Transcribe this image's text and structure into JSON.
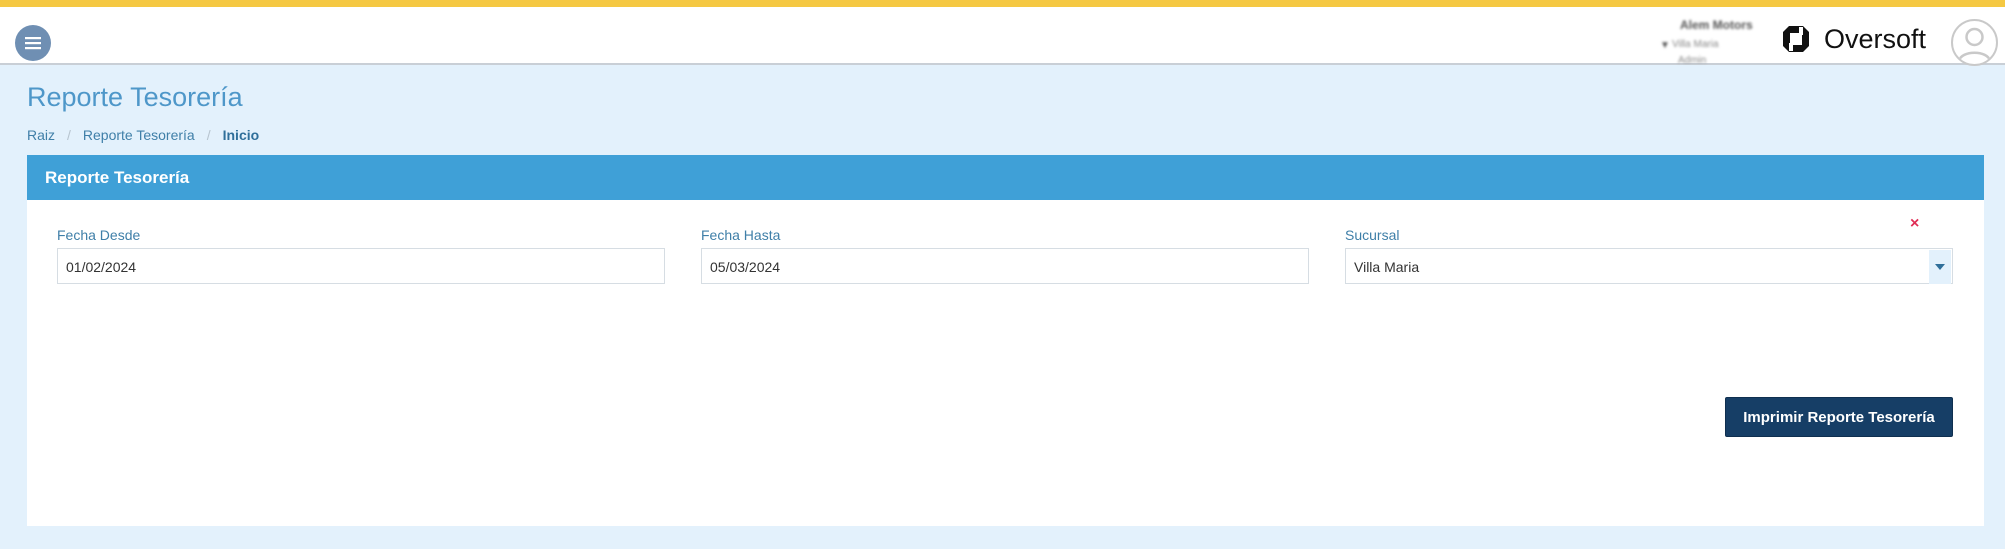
{
  "colors": {
    "accent_bar": "#f5c842",
    "header_bar": "#3fa0d7",
    "page_background": "#e3f1fc",
    "primary_button": "#163e66",
    "clear_icon": "#e02d55"
  },
  "navbar": {
    "menu_icon": "hamburger-icon",
    "company": {
      "name": "Alem Motors",
      "location": "Villa Maria",
      "user": "Admin"
    },
    "brand_name": "Oversoft",
    "avatar_icon": "user-avatar-icon"
  },
  "page": {
    "title": "Reporte Tesorería",
    "breadcrumb": [
      "Raiz",
      "Reporte Tesorería",
      "Inicio"
    ],
    "breadcrumb_separator": "/"
  },
  "panel": {
    "header": "Reporte Tesorería",
    "fields": {
      "fecha_desde": {
        "label": "Fecha Desde",
        "value": "01/02/2024"
      },
      "fecha_hasta": {
        "label": "Fecha Hasta",
        "value": "05/03/2024"
      },
      "sucursal": {
        "label": "Sucursal",
        "value": "Villa Maria"
      }
    },
    "clear_symbol": "×",
    "print_button": "Imprimir Reporte Tesorería"
  }
}
